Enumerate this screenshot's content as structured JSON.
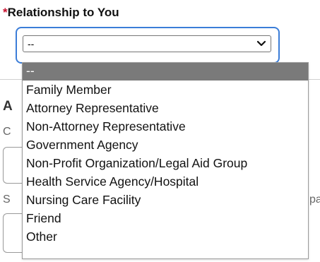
{
  "field": {
    "required_marker": "*",
    "label": "Relationship to You"
  },
  "select": {
    "value": "--",
    "chevron_icon": "chevron-down-icon"
  },
  "dropdown": {
    "options": [
      "--",
      "Family Member",
      "Attorney Representative",
      "Non-Attorney Representative",
      "Government Agency",
      "Non-Profit Organization/Legal Aid Group",
      "Health Service Agency/Hospital",
      "Nursing Care Facility",
      "Friend",
      "Other"
    ],
    "selected_index": 0
  },
  "background": {
    "heading_fragment": "A",
    "label_fragment_1": "C",
    "label_fragment_2": "S",
    "label_fragment_3": "pa"
  },
  "colors": {
    "required": "#c8102e",
    "focus_ring": "#3b7dd8",
    "selected_option_bg": "#7a7a7a"
  }
}
